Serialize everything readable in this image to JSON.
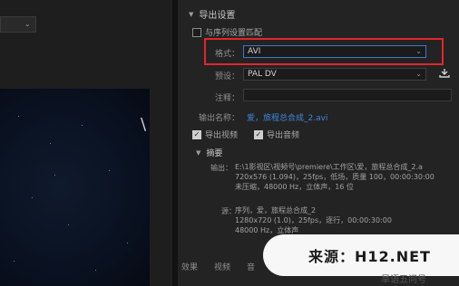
{
  "export_settings": {
    "section_title": "导出设置",
    "match_sequence_label": "与序列设置匹配",
    "format_label": "格式：",
    "format_value": "AVI",
    "preset_label": "预设：",
    "preset_value": "PAL DV",
    "comment_label": "注释：",
    "output_name_label": "输出名称：",
    "output_name_value": "爱，旅程总合成_2.avi",
    "export_video_label": "导出视频",
    "export_audio_label": "导出音频",
    "summary_title": "摘要",
    "output_label": "输出：",
    "output_lines": [
      "E:\\1影视区\\视频号\\premiere\\工作区\\爱，旅程总合成_2.a",
      "720x576 (1.094)，25fps，低场，质量 100，00:00:30:00",
      "未压缩，48000 Hz，立体声，16 位"
    ],
    "source_label": "源：",
    "source_lines": [
      "序列，爱，旅程总合成_2",
      "1280x720 (1.0)，25fps，逐行，00:00:30:00",
      "48000 Hz，立体声"
    ]
  },
  "bottom_tabs": [
    "效果",
    "视频",
    "音"
  ],
  "watermark": {
    "text": "来源：H12.NET",
    "under_text": "旱语五问号"
  },
  "colors": {
    "highlight": "#e2262b",
    "link": "#3f86d9",
    "active_border": "#3f78c8"
  }
}
